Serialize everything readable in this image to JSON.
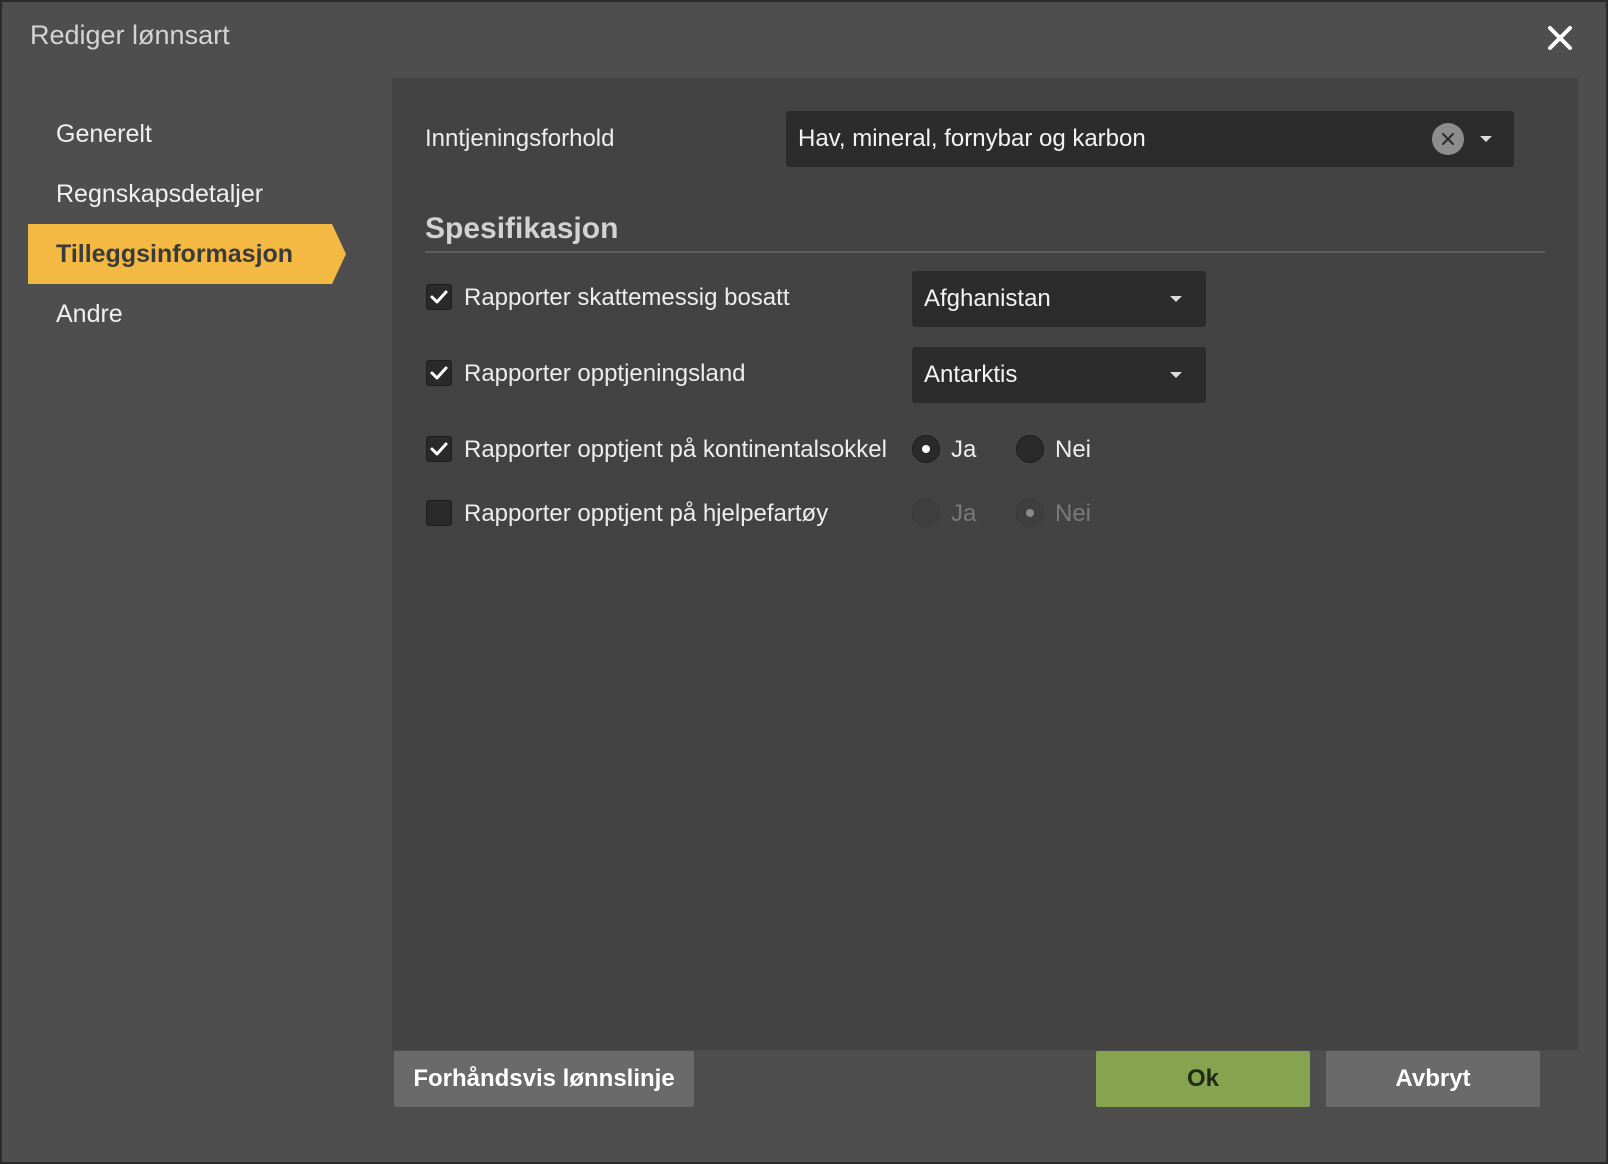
{
  "dialog": {
    "title": "Rediger lønnsart",
    "close_icon": "close-icon"
  },
  "nav": {
    "items": [
      {
        "label": "Generelt",
        "active": false
      },
      {
        "label": "Regnskapsdetaljer",
        "active": false
      },
      {
        "label": "Tilleggsinformasjon",
        "active": true
      },
      {
        "label": "Andre",
        "active": false
      }
    ]
  },
  "form": {
    "earning": {
      "label": "Inntjeningsforhold",
      "value": "Hav, mineral, fornybar og karbon"
    },
    "section_title": "Spesifikasjon",
    "rows": [
      {
        "label": "Rapporter skattemessig bosatt",
        "checked": true,
        "select_value": "Afghanistan"
      },
      {
        "label": "Rapporter opptjeningsland",
        "checked": true,
        "select_value": "Antarktis"
      },
      {
        "label": "Rapporter opptjent på kontinentalsokkel",
        "checked": true,
        "radio_yes": "Ja",
        "radio_no": "Nei",
        "selected": "Ja",
        "disabled": false
      },
      {
        "label": "Rapporter opptjent på hjelpefartøy",
        "checked": false,
        "radio_yes": "Ja",
        "radio_no": "Nei",
        "selected": "Nei",
        "disabled": true
      }
    ]
  },
  "footer": {
    "preview_label": "Forhåndsvis lønnslinje",
    "ok_label": "Ok",
    "cancel_label": "Avbryt"
  },
  "colors": {
    "accent": "#f4b942",
    "ok_button": "#86a34f",
    "dialog_bg": "#4e4e4e",
    "panel_bg": "#434343"
  }
}
